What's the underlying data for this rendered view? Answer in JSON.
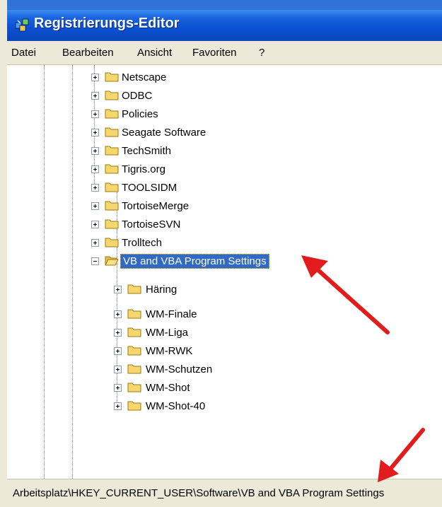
{
  "window": {
    "title": "Registrierungs-Editor"
  },
  "menu": [
    "Datei",
    "Bearbeiten",
    "Ansicht",
    "Favoriten",
    "?"
  ],
  "tree": {
    "items": [
      {
        "label": "Netscape",
        "expanded": false
      },
      {
        "label": "ODBC",
        "expanded": false
      },
      {
        "label": "Policies",
        "expanded": false
      },
      {
        "label": "Seagate Software",
        "expanded": false
      },
      {
        "label": "TechSmith",
        "expanded": false
      },
      {
        "label": "Tigris.org",
        "expanded": false
      },
      {
        "label": "TOOLSIDM",
        "expanded": false
      },
      {
        "label": "TortoiseMerge",
        "expanded": false
      },
      {
        "label": "TortoiseSVN",
        "expanded": false
      },
      {
        "label": "Trolltech",
        "expanded": false
      },
      {
        "label": "VB and VBA Program Settings",
        "expanded": true,
        "selected": true
      }
    ],
    "children": [
      {
        "label": "Häring"
      },
      {
        "label": "WM-Finale"
      },
      {
        "label": "WM-Liga"
      },
      {
        "label": "WM-RWK"
      },
      {
        "label": "WM-Schutzen"
      },
      {
        "label": "WM-Shot"
      },
      {
        "label": "WM-Shot-40"
      }
    ]
  },
  "status": {
    "path": "Arbeitsplatz\\HKEY_CURRENT_USER\\Software\\VB and VBA Program Settings"
  },
  "colors": {
    "titlebar": "#0a4fd0",
    "selection": "#316ac5",
    "folder": "#f5d76e",
    "annotation_arrow": "#e21c1c"
  }
}
